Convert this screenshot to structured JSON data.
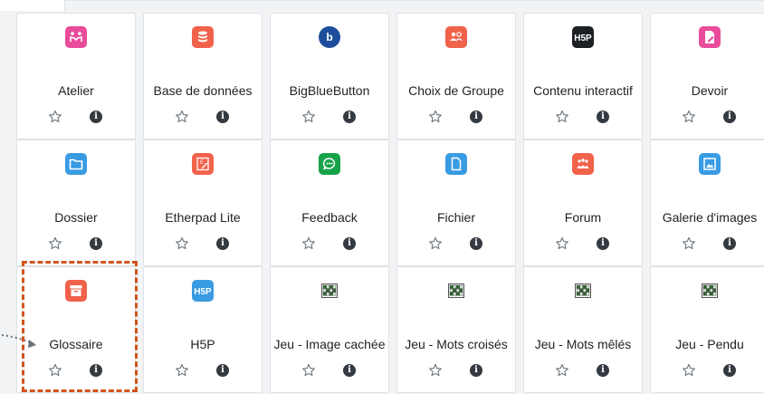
{
  "activities": [
    {
      "id": "atelier",
      "label": "Atelier",
      "icon": "workshop-icon",
      "color": "#e94c9b"
    },
    {
      "id": "base-de-donnees",
      "label": "Base de données",
      "icon": "database-icon",
      "color": "#f1624a"
    },
    {
      "id": "bigbluebutton",
      "label": "BigBlueButton",
      "icon": "bigbluebutton-icon",
      "color": "#1c4e9c"
    },
    {
      "id": "choix-de-groupe",
      "label": "Choix de Groupe",
      "icon": "group-choice-icon",
      "color": "#f1624a"
    },
    {
      "id": "contenu-interactif",
      "label": "Contenu interactif",
      "icon": "h5p-icon",
      "color": "#1d2125"
    },
    {
      "id": "devoir",
      "label": "Devoir",
      "icon": "assignment-icon",
      "color": "#e94c9b"
    },
    {
      "id": "dossier",
      "label": "Dossier",
      "icon": "folder-icon",
      "color": "#399be2"
    },
    {
      "id": "etherpad-lite",
      "label": "Etherpad Lite",
      "icon": "etherpad-icon",
      "color": "#f1624a"
    },
    {
      "id": "feedback",
      "label": "Feedback",
      "icon": "feedback-icon",
      "color": "#16a34a"
    },
    {
      "id": "fichier",
      "label": "Fichier",
      "icon": "file-icon",
      "color": "#399be2"
    },
    {
      "id": "forum",
      "label": "Forum",
      "icon": "forum-icon",
      "color": "#f1624a"
    },
    {
      "id": "galerie-images",
      "label": "Galerie d'images",
      "icon": "image-gallery-icon",
      "color": "#399be2"
    },
    {
      "id": "glossaire",
      "label": "Glossaire",
      "icon": "glossary-icon",
      "color": "#f1624a"
    },
    {
      "id": "h5p",
      "label": "H5P",
      "icon": "h5p-icon",
      "color": "#399be2"
    },
    {
      "id": "jeu-image-cachee",
      "label": "Jeu - Image cachée",
      "icon": "game-icon",
      "color": "#5a8a3c"
    },
    {
      "id": "jeu-mots-croises",
      "label": "Jeu - Mots croisés",
      "icon": "game-icon",
      "color": "#5a8a3c"
    },
    {
      "id": "jeu-mots-meles",
      "label": "Jeu - Mots mêlés",
      "icon": "game-icon",
      "color": "#5a8a3c"
    },
    {
      "id": "jeu-pendu",
      "label": "Jeu - Pendu",
      "icon": "game-icon",
      "color": "#5a8a3c"
    }
  ],
  "highlighted": "glossaire",
  "colors": {
    "highlight": "#d1541b",
    "info": "#343a40",
    "star": "#6a737b"
  }
}
